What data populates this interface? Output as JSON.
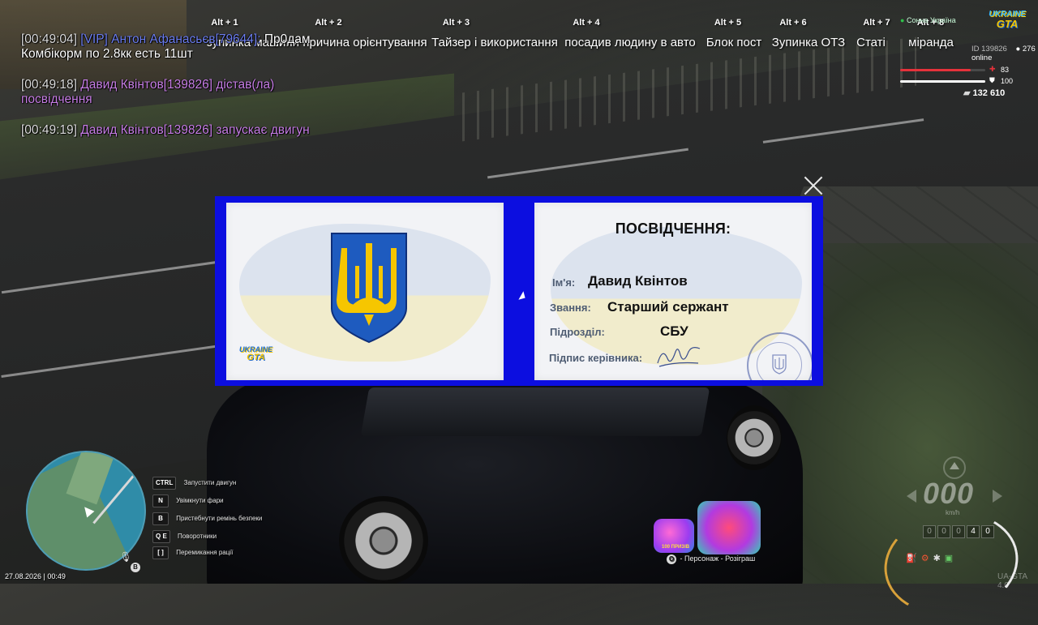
{
  "alt_menu": [
    {
      "key": "Alt + 1",
      "label": "зупинка машини"
    },
    {
      "key": "Alt + 2",
      "label": "причина орієнтування"
    },
    {
      "key": "Alt + 3",
      "label": "Тайзер і використання"
    },
    {
      "key": "Alt + 4",
      "label": "посадив людину в авто"
    },
    {
      "key": "Alt + 5",
      "label": "Блок пост"
    },
    {
      "key": "Alt + 6",
      "label": "Зупинка ОТЗ"
    },
    {
      "key": "Alt + 7",
      "label": "Статі"
    },
    {
      "key": "Alt + 8",
      "label": "міранда"
    }
  ],
  "chat": [
    {
      "time": "[00:49:04]",
      "name": "[VIP] Антон Афанасьєв[79644]:",
      "text": "Пр0дам Комбікорм по 2.8кк есть 11шт"
    },
    {
      "time": "[00:49:18]",
      "name": "Давид Квінтов[139826]",
      "text": "дістав(ла) посвідчення"
    },
    {
      "time": "[00:49:19]",
      "name": "Давид Квінтов[139826]",
      "text": "запускає двигун"
    }
  ],
  "hud": {
    "logo_top": "UKRAINE",
    "logo_bottom": "GTA",
    "server": "Сонна Україна",
    "player_id": "ID 139826",
    "online": "276 online",
    "health": "83",
    "armor": "100",
    "money": "132 610",
    "health_fraction": 0.83,
    "armor_fraction": 1.0,
    "colors": {
      "health": "#e5323b",
      "armor": "#ffffff",
      "card_border": "#0c0ee0"
    }
  },
  "id_card": {
    "title": "ПОСВІДЧЕННЯ:",
    "name_label": "Ім'я:",
    "name": "Давид Квінтов",
    "rank_label": "Звання:",
    "rank": "Старший сержант",
    "unit_label": "Підрозділ:",
    "unit": "СБУ",
    "signature_label": "Підпис керівника:",
    "logo_top": "UKRAINE",
    "logo_bottom": "GTA",
    "close_icon": "close-icon",
    "emblem_icon": "coat-of-arms-icon"
  },
  "controls": [
    {
      "key": "CTRL",
      "label": "Запустити двигун"
    },
    {
      "key": "N",
      "label": "Увімкнути фари"
    },
    {
      "key": "B",
      "label": "Пристебнути ремінь безпеки"
    },
    {
      "key": "Q  E",
      "label": "Поворотники"
    },
    {
      "key": "[  ]",
      "label": "Перемикання рації"
    }
  ],
  "datetime": "27.08.2026 | 00:49",
  "mic_key": "B",
  "promo": {
    "tag": "100 ПРИЗІВ",
    "key1": "O",
    "text": "- Персонаж - Розіграш"
  },
  "speedometer": {
    "speed": "000",
    "unit": "km/h",
    "odometer": [
      "0",
      "0",
      "0",
      "4",
      "0"
    ],
    "odometer_active": [
      false,
      false,
      false,
      true,
      true
    ]
  },
  "version": "UA-GTA 4.0"
}
